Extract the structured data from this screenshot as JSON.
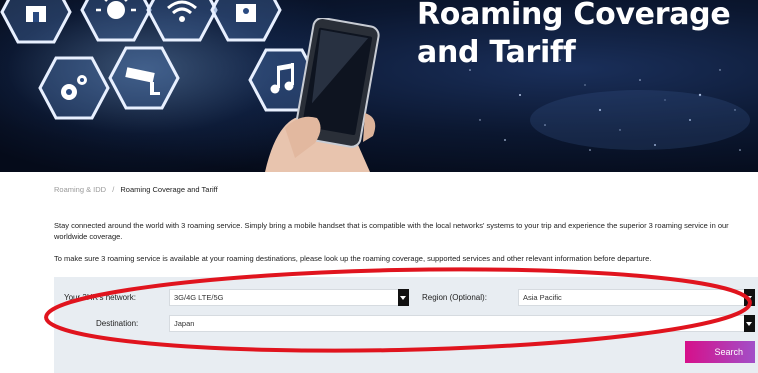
{
  "hero": {
    "title_line1": "Roaming Coverage",
    "title_line2": "and Tariff",
    "icons": [
      "home-icon",
      "sun-icon",
      "wifi-icon",
      "lock-icon",
      "gear-icon",
      "cctv-camera-icon",
      "music-note-icon"
    ]
  },
  "breadcrumb": {
    "parent": "Roaming & IDD",
    "separator": "/",
    "current": "Roaming Coverage and Tariff"
  },
  "intro": {
    "paragraph1": "Stay connected around the world with 3 roaming service. Simply bring a mobile handset that is compatible with the local networks' systems to your trip and experience the superior 3 roaming service in our worldwide coverage.",
    "paragraph2": "To make sure 3 roaming service is available at your roaming destinations, please look up the roaming coverage, supported services and other relevant information before departure."
  },
  "search_form": {
    "network_label": "Your 3HK's network:",
    "network_value": "3G/4G LTE/5G",
    "region_label": "Region (Optional):",
    "region_value": "Asia Pacific",
    "destination_label": "Destination:",
    "destination_value": "Japan",
    "search_label": "Search"
  },
  "colors": {
    "search_gradient_start": "#d6108a",
    "search_gradient_end": "#a24fc8",
    "panel_background": "#e8edf2",
    "annotation": "#e0141e"
  }
}
